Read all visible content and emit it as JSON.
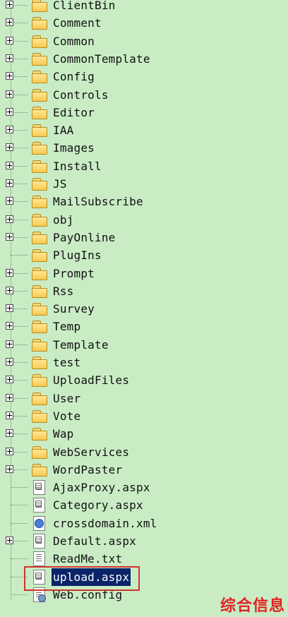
{
  "tree": {
    "items": [
      {
        "type": "folder",
        "label": "ClientBin",
        "expander": true
      },
      {
        "type": "folder",
        "label": "Comment",
        "expander": true
      },
      {
        "type": "folder",
        "label": "Common",
        "expander": true
      },
      {
        "type": "folder",
        "label": "CommonTemplate",
        "expander": true
      },
      {
        "type": "folder",
        "label": "Config",
        "expander": true
      },
      {
        "type": "folder",
        "label": "Controls",
        "expander": true
      },
      {
        "type": "folder",
        "label": "Editor",
        "expander": true
      },
      {
        "type": "folder",
        "label": "IAA",
        "expander": true
      },
      {
        "type": "folder",
        "label": "Images",
        "expander": true
      },
      {
        "type": "folder",
        "label": "Install",
        "expander": true
      },
      {
        "type": "folder",
        "label": "JS",
        "expander": true
      },
      {
        "type": "folder",
        "label": "MailSubscribe",
        "expander": true
      },
      {
        "type": "folder",
        "label": "obj",
        "expander": true
      },
      {
        "type": "folder",
        "label": "PayOnline",
        "expander": true
      },
      {
        "type": "folder",
        "label": "PlugIns",
        "expander": false
      },
      {
        "type": "folder",
        "label": "Prompt",
        "expander": true
      },
      {
        "type": "folder",
        "label": "Rss",
        "expander": true
      },
      {
        "type": "folder",
        "label": "Survey",
        "expander": true
      },
      {
        "type": "folder",
        "label": "Temp",
        "expander": true
      },
      {
        "type": "folder",
        "label": "Template",
        "expander": true
      },
      {
        "type": "folder",
        "label": "test",
        "expander": true
      },
      {
        "type": "folder",
        "label": "UploadFiles",
        "expander": true
      },
      {
        "type": "folder",
        "label": "User",
        "expander": true
      },
      {
        "type": "folder",
        "label": "Vote",
        "expander": true
      },
      {
        "type": "folder",
        "label": "Wap",
        "expander": true
      },
      {
        "type": "folder",
        "label": "WebServices",
        "expander": true
      },
      {
        "type": "folder",
        "label": "WordPaster",
        "expander": true
      },
      {
        "type": "aspx",
        "label": "AjaxProxy.aspx",
        "expander": false
      },
      {
        "type": "aspx",
        "label": "Category.aspx",
        "expander": false
      },
      {
        "type": "xml",
        "label": "crossdomain.xml",
        "expander": false
      },
      {
        "type": "aspx",
        "label": "Default.aspx",
        "expander": true
      },
      {
        "type": "txt",
        "label": "ReadMe.txt",
        "expander": false
      },
      {
        "type": "aspx",
        "label": "upload.aspx",
        "expander": false,
        "selected": true
      },
      {
        "type": "config",
        "label": "Web.config",
        "expander": false
      }
    ]
  },
  "colors": {
    "background": "#c9ecc5",
    "selection": "#0a246a",
    "highlight_box": "#d1342c",
    "watermark": "#e12222"
  },
  "watermark": {
    "text": "综合信息"
  }
}
